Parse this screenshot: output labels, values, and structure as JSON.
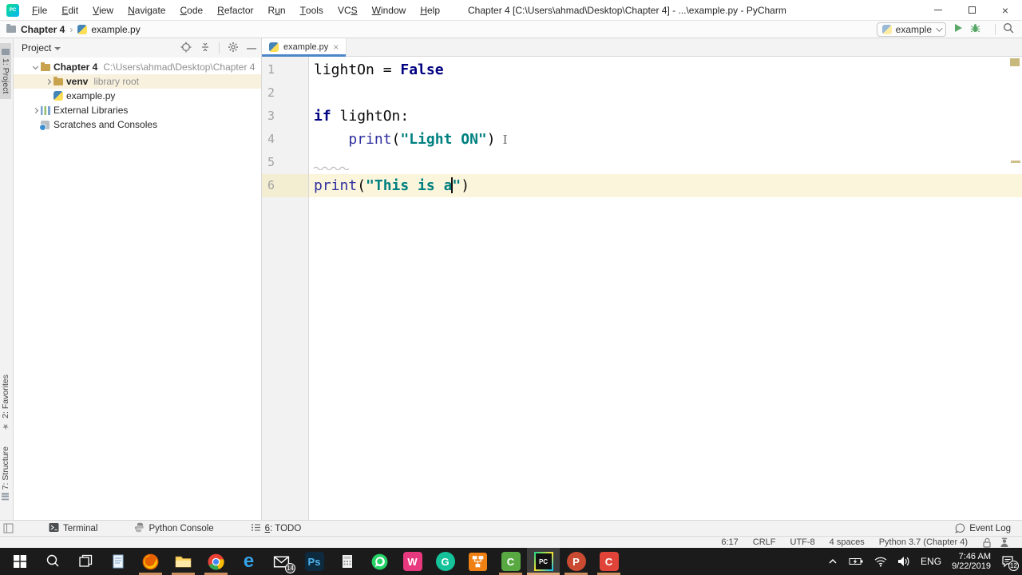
{
  "titlebar": {
    "app_icon": "pycharm-logo",
    "app_icon_text": "PC",
    "menus": [
      {
        "label": "File",
        "u": 0
      },
      {
        "label": "Edit",
        "u": 0
      },
      {
        "label": "View",
        "u": 0
      },
      {
        "label": "Navigate",
        "u": 0
      },
      {
        "label": "Code",
        "u": 0
      },
      {
        "label": "Refactor",
        "u": 0
      },
      {
        "label": "Run",
        "u": 1
      },
      {
        "label": "Tools",
        "u": 0
      },
      {
        "label": "VCS",
        "u": 2
      },
      {
        "label": "Window",
        "u": 0
      },
      {
        "label": "Help",
        "u": 0
      }
    ],
    "title": "Chapter 4 [C:\\Users\\ahmad\\Desktop\\Chapter 4] - ...\\example.py - PyCharm",
    "controls": [
      "minimize",
      "maximize",
      "close"
    ]
  },
  "navbar": {
    "breadcrumb_root": "Chapter 4",
    "breadcrumb_file": "example.py",
    "separator": "›",
    "run": {
      "selected_config": "example"
    }
  },
  "stripe": {
    "top": {
      "label": "1: Project",
      "active": true
    },
    "bottom": [
      {
        "label": "2: Favorites"
      },
      {
        "label": "7: Structure"
      }
    ]
  },
  "project": {
    "header": {
      "title": "Project",
      "actions": [
        "locate-icon",
        "collapse-all-icon",
        "settings-gear-icon",
        "hide-icon"
      ]
    },
    "tree": [
      {
        "label": "Chapter 4",
        "suffix": "C:\\Users\\ahmad\\Desktop\\Chapter 4",
        "icon": "folder",
        "chevron": "expanded",
        "depth": 0,
        "bold": true,
        "selected": false
      },
      {
        "label": "venv",
        "suffix": "library root",
        "icon": "folder",
        "chevron": "collapsed",
        "depth": 1,
        "bold": true,
        "selected": true
      },
      {
        "label": "example.py",
        "suffix": "",
        "icon": "python",
        "chevron": "none",
        "depth": 1,
        "bold": false,
        "selected": false
      },
      {
        "label": "External Libraries",
        "suffix": "",
        "icon": "libraries",
        "chevron": "collapsed",
        "depth": 0,
        "bold": false,
        "selected": false
      },
      {
        "label": "Scratches and Consoles",
        "suffix": "",
        "icon": "scratches",
        "chevron": "none",
        "depth": 0,
        "bold": false,
        "selected": false
      }
    ]
  },
  "editor": {
    "tab": {
      "label": "example.py",
      "close": "×"
    },
    "lines": [
      {
        "n": "1",
        "tokens": [
          {
            "t": "lightOn = ",
            "c": "plain"
          },
          {
            "t": "False",
            "c": "kw"
          }
        ],
        "current": false,
        "squiggle": false,
        "ibeam": false
      },
      {
        "n": "2",
        "tokens": [],
        "current": false,
        "squiggle": false,
        "ibeam": false
      },
      {
        "n": "3",
        "tokens": [
          {
            "t": "if",
            "c": "kw"
          },
          {
            "t": " lightOn:",
            "c": "plain"
          }
        ],
        "current": false,
        "squiggle": false,
        "ibeam": false
      },
      {
        "n": "4",
        "tokens": [
          {
            "t": "    ",
            "c": "plain"
          },
          {
            "t": "print",
            "c": "builtin"
          },
          {
            "t": "(",
            "c": "plain"
          },
          {
            "t": "\"Light ON\"",
            "c": "str"
          },
          {
            "t": ")",
            "c": "plain"
          }
        ],
        "current": false,
        "squiggle": false,
        "ibeam": true
      },
      {
        "n": "5",
        "tokens": [],
        "current": false,
        "squiggle": true,
        "ibeam": false
      },
      {
        "n": "6",
        "tokens": [
          {
            "t": "print",
            "c": "builtin"
          },
          {
            "t": "(",
            "c": "plain"
          },
          {
            "t": "\"This is a",
            "c": "str"
          },
          {
            "t": "",
            "c": "caret"
          },
          {
            "t": "\"",
            "c": "str"
          },
          {
            "t": ")",
            "c": "plain"
          }
        ],
        "current": true,
        "squiggle": false,
        "ibeam": false
      }
    ],
    "scroll_markers": [
      "warning-square",
      "warning-dash"
    ]
  },
  "bottombar": {
    "items": [
      {
        "icon": "terminal-icon",
        "label": "Terminal",
        "u": -1
      },
      {
        "icon": "python-console-icon",
        "label": "Python Console",
        "u": -1
      },
      {
        "icon": "todo-icon",
        "label": "6: TODO",
        "u": 0
      }
    ],
    "event_log": "Event Log"
  },
  "statusbar": {
    "items": [
      "6:17",
      "CRLF",
      "UTF-8",
      "4 spaces",
      "Python 3.7 (Chapter 4)"
    ],
    "icons": [
      "lock-icon",
      "hector-inspections-icon"
    ]
  },
  "taskbar": {
    "apps": [
      {
        "name": "start",
        "kind": "svg",
        "running": false,
        "active": false
      },
      {
        "name": "search",
        "kind": "svg",
        "running": false,
        "active": false
      },
      {
        "name": "task-view",
        "kind": "svg",
        "running": false,
        "active": false
      },
      {
        "name": "notepad",
        "kind": "svg",
        "running": false,
        "active": false
      },
      {
        "name": "firefox",
        "kind": "svg",
        "running": true,
        "active": false
      },
      {
        "name": "file-explorer",
        "kind": "svg",
        "running": true,
        "active": false
      },
      {
        "name": "chrome",
        "kind": "svg",
        "running": true,
        "active": false
      },
      {
        "name": "edge",
        "kind": "letter",
        "letter": "e",
        "bg": "transparent",
        "fg": "#35a3e8",
        "shape": "none",
        "running": false,
        "active": false
      },
      {
        "name": "mail",
        "kind": "svg",
        "badge": "14",
        "running": false,
        "active": false
      },
      {
        "name": "photoshop",
        "kind": "letter",
        "letter": "Ps",
        "bg": "#0d2a3f",
        "fg": "#4fb5f0",
        "shape": "square",
        "running": false,
        "active": false
      },
      {
        "name": "calculator",
        "kind": "svg",
        "running": false,
        "active": false
      },
      {
        "name": "whatsapp",
        "kind": "svg",
        "running": false,
        "active": false
      },
      {
        "name": "filmora",
        "kind": "letter",
        "letter": "W",
        "bg": "#e8397e",
        "fg": "#ffffff",
        "shape": "square",
        "running": false,
        "active": false
      },
      {
        "name": "grammarly",
        "kind": "letter",
        "letter": "G",
        "bg": "#15c39a",
        "fg": "#ffffff",
        "shape": "circle",
        "running": false,
        "active": false
      },
      {
        "name": "diagram",
        "kind": "svg",
        "running": false,
        "active": false
      },
      {
        "name": "camtasia",
        "kind": "letter",
        "letter": "C",
        "bg": "#58a942",
        "fg": "#ffffff",
        "shape": "square",
        "running": true,
        "active": false
      },
      {
        "name": "pycharm",
        "kind": "letter",
        "letter": "PC",
        "bg": "#121212",
        "fg": "#ffffff",
        "shape": "square",
        "running": true,
        "active": true
      },
      {
        "name": "powerpoint",
        "kind": "letter",
        "letter": "P",
        "bg": "#cb4a32",
        "fg": "#ffffff",
        "shape": "circle",
        "running": true,
        "active": false
      },
      {
        "name": "camtasia-recorder",
        "kind": "letter",
        "letter": "C",
        "bg": "#e04438",
        "fg": "#ffffff",
        "shape": "square",
        "running": true,
        "active": false
      }
    ],
    "tray": {
      "language": "ENG",
      "time": "7:46 AM",
      "date": "9/22/2019",
      "notification_badge": "12"
    }
  },
  "colors": {
    "keyword": "#000080",
    "string": "#008080",
    "builtin": "#30309f",
    "current_line": "#fbf5dc",
    "selection_unfocused": "#f7f1dd",
    "tab_underline": "#4a86c8",
    "run_green": "#59a869",
    "taskbar_underline": "#c98f5f"
  }
}
